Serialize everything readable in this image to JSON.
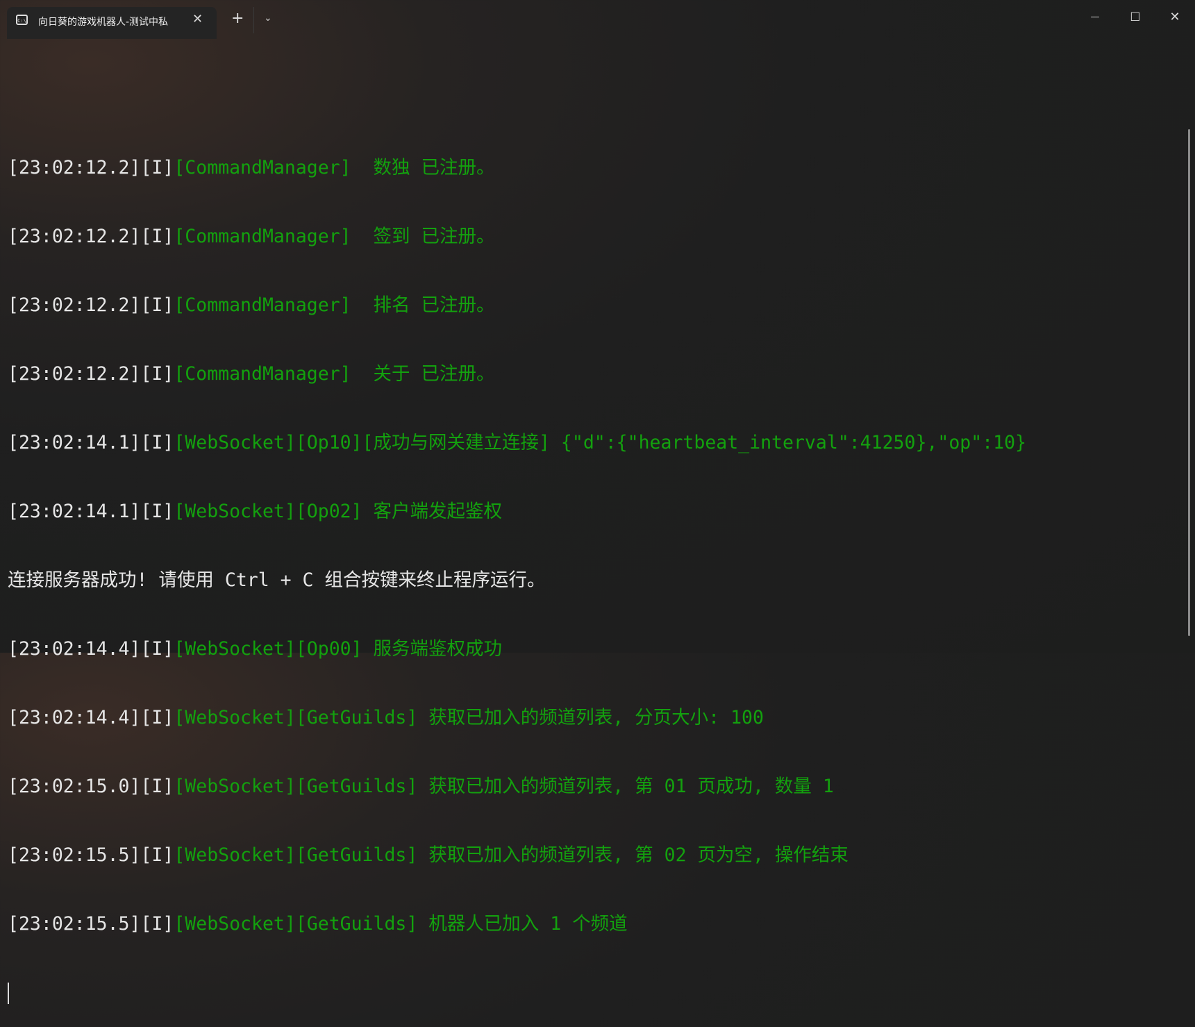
{
  "tab": {
    "title": "向日葵的游戏机器人-测试中私",
    "icon": "terminal-icon",
    "icon_text": "C:\\",
    "close": "✕"
  },
  "titlebar": {
    "new_tab": "+",
    "dropdown": "⌄",
    "minimize": "—",
    "maximize": "☐",
    "close": "✕"
  },
  "colors": {
    "green": "#13a10e",
    "foreground": "#cccccc"
  },
  "lines": [
    {
      "w": "[23:02:12.2][I]",
      "g": "[CommandManager]  数独 已注册。"
    },
    {
      "w": "[23:02:12.2][I]",
      "g": "[CommandManager]  签到 已注册。"
    },
    {
      "w": "[23:02:12.2][I]",
      "g": "[CommandManager]  排名 已注册。"
    },
    {
      "w": "[23:02:12.2][I]",
      "g": "[CommandManager]  关于 已注册。"
    },
    {
      "w": "[23:02:14.1][I]",
      "g": "[WebSocket][Op10][成功与网关建立连接] {\"d\":{\"heartbeat_interval\":41250},\"op\":10}"
    },
    {
      "w": "[23:02:14.1][I]",
      "g": "[WebSocket][Op02] 客户端发起鉴权"
    },
    {
      "w": "连接服务器成功! 请使用 Ctrl + C 组合按键来终止程序运行。",
      "g": ""
    },
    {
      "w": "[23:02:14.4][I]",
      "g": "[WebSocket][Op00] 服务端鉴权成功"
    },
    {
      "w": "[23:02:14.4][I]",
      "g": "[WebSocket][GetGuilds] 获取已加入的频道列表, 分页大小: 100"
    },
    {
      "w": "[23:02:15.0][I]",
      "g": "[WebSocket][GetGuilds] 获取已加入的频道列表, 第 01 页成功, 数量 1"
    },
    {
      "w": "[23:02:15.5][I]",
      "g": "[WebSocket][GetGuilds] 获取已加入的频道列表, 第 02 页为空, 操作结束"
    },
    {
      "w": "[23:02:15.5][I]",
      "g": "[WebSocket][GetGuilds] 机器人已加入 1 个频道"
    }
  ]
}
